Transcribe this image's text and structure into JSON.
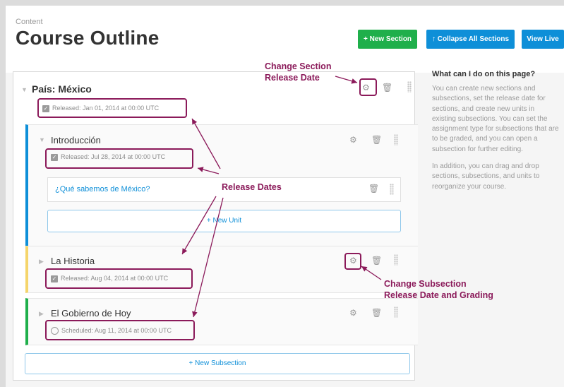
{
  "header": {
    "breadcrumb": "Content",
    "title": "Course Outline",
    "buttons": {
      "new_section": "+ New Section",
      "collapse_all": "↑  Collapse All Sections",
      "view_live": "View Live"
    }
  },
  "section": {
    "title": "País: México",
    "status": "Released: Jan 01, 2014 at 00:00 UTC"
  },
  "subsections": [
    {
      "title": "Introducción",
      "status": "Released: Jul 28, 2014 at 00:00 UTC",
      "accent": "#0e8fd8",
      "units": [
        "¿Qué sabemos de México?"
      ],
      "new_unit_label": "+ New Unit"
    },
    {
      "title": "La Historia",
      "status": "Released: Aug 04, 2014 at 00:00 UTC",
      "accent": "#f5d56b"
    },
    {
      "title": "El Gobierno de Hoy",
      "status": "Scheduled: Aug 11, 2014 at 00:00 UTC",
      "accent": "#1faf4b"
    }
  ],
  "new_subsection_label": "+ New Subsection",
  "help": {
    "heading": "What can I do on this page?",
    "paragraphs": [
      "You can create new sections and subsections, set the release date for sections, and create new units in existing subsections. You can set the assignment type for subsections that are to be graded, and you can open a subsection for further editing.",
      "In addition, you can drag and drop sections, subsections, and units to reorganize your course."
    ]
  },
  "annotations": {
    "change_section_line1": "Change Section",
    "change_section_line2": "Release Date",
    "release_dates": "Release Dates",
    "change_subsection_line1": "Change Subsection",
    "change_subsection_line2": "Release Date and Grading"
  },
  "colors": {
    "annotation": "#8b1a5a",
    "primary_blue": "#0e8fd8",
    "primary_green": "#1faf4b"
  },
  "icons": [
    "gear-icon",
    "trash-icon",
    "drag-handle-icon",
    "checkbox-icon",
    "clock-icon",
    "expand-triangle-icon"
  ]
}
